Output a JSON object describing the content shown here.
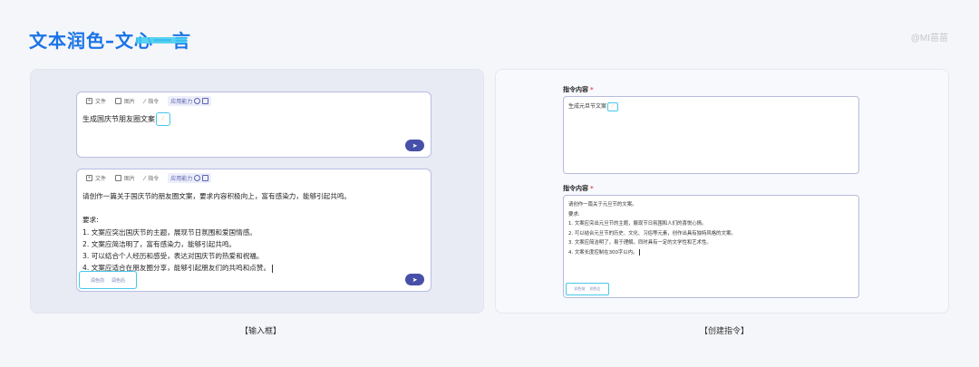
{
  "header": {
    "title": "文本润色–文心一言",
    "author": "@MI苗苗",
    "accent": "#1a73e8"
  },
  "left_panel": {
    "caption": "【输入框】",
    "toolbar": {
      "file_label": "文件",
      "image_label": "图片",
      "command_label": "指令",
      "capability_label": "应用能力"
    },
    "box1": {
      "text": "生成国庆节朋友圈文案"
    },
    "box2": {
      "lines": [
        "请创作一篇关于国庆节的朋友圈文案，要求内容积极向上，富有感染力，能够引起共鸣。",
        "",
        "要求:",
        "1. 文案应突出国庆节的主题，展现节日氛围和爱国情感。",
        "2. 文案应简洁明了，富有感染力，能够引起共鸣。",
        "3. 可以结合个人经历和感受，表达对国庆节的热爱和祝福。",
        "4. 文案应适合在朋友圈分享，能够引起朋友们的共鸣和点赞。"
      ],
      "actions": [
        "润色前",
        "润色后"
      ]
    },
    "send_icon": "paper-plane-icon"
  },
  "right_panel": {
    "caption": "【创建指令】",
    "field1": {
      "label": "指令内容",
      "value": "生成元旦节文案"
    },
    "field2": {
      "label": "指令内容",
      "lines": [
        "请创作一篇关于元旦节的文案。",
        "要求:",
        "1. 文案应突出元旦节的主题，展现节日氛围和人们的喜悦心情。",
        "2. 可以结合元旦节的历史、文化、习俗等元素，创作出具有独特风格的文案。",
        "3. 文案应简洁明了，易于理解，同时具有一定的文学性和艺术性。",
        "4. 文案长度控制在300字以内。"
      ],
      "actions": [
        "润色前",
        "润色后"
      ]
    }
  }
}
